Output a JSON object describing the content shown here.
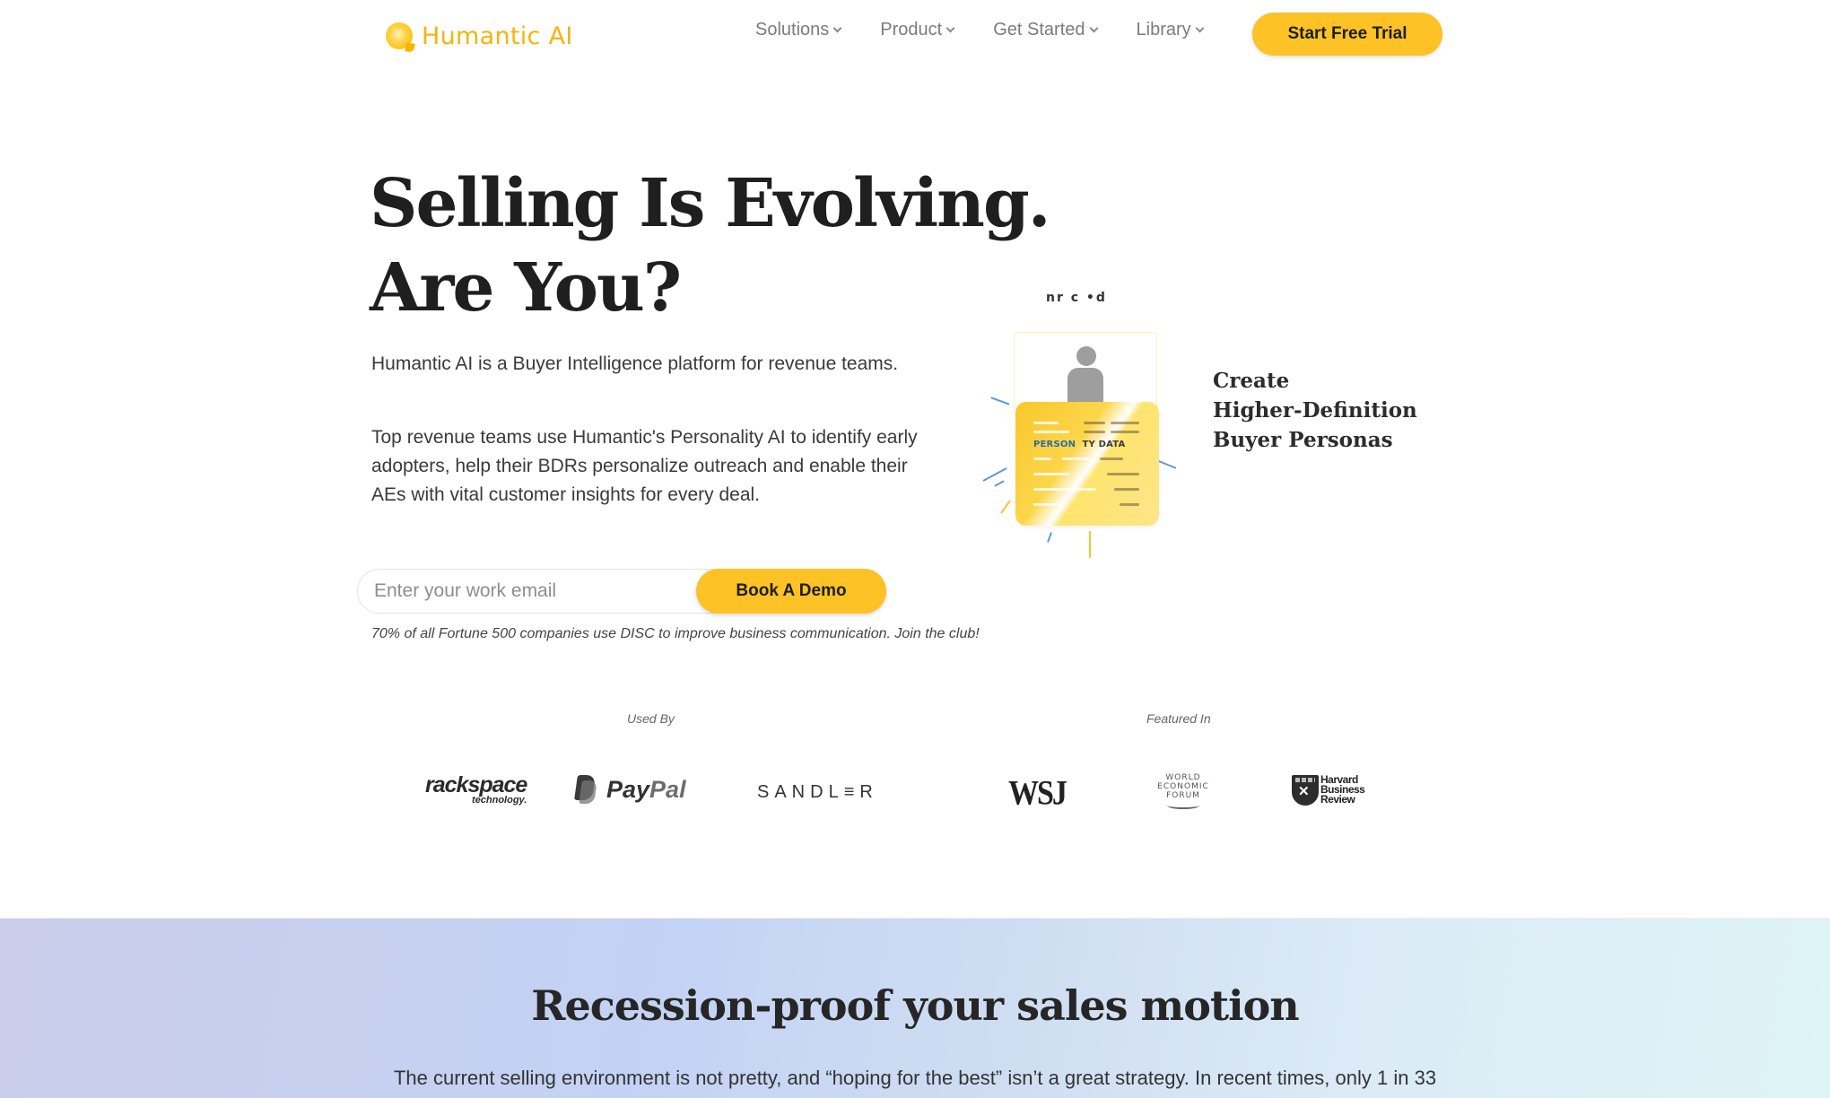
{
  "nav": {
    "logo_text": "Humantic AI",
    "menu": [
      {
        "label": "Solutions"
      },
      {
        "label": "Product"
      },
      {
        "label": "Get Started"
      },
      {
        "label": "Library"
      }
    ],
    "cta_label": "Start Free Trial"
  },
  "hero": {
    "title_line1": "Selling Is Evolving.",
    "title_line2": "Are You?",
    "paragraph1": "Humantic AI is a Buyer Intelligence platform for revenue teams.",
    "paragraph2": "Top revenue teams use Humantic's Personality AI to identify early adopters, help their BDRs personalize outreach and enable their AEs with vital customer insights for every deal.",
    "email_placeholder": "Enter your work email",
    "email_value": "",
    "demo_button_label": "Book A Demo",
    "fortune_note": "70% of all Fortune 500 companies use DISC to improve business communication. Join the club!"
  },
  "illustration": {
    "garbled_text": "nr c  •d",
    "card_label_part1": "PERSON",
    "card_label_part2": "  TY DATA",
    "feature_line1": "Create",
    "feature_line2": "Higher-Definition",
    "feature_line3": "Buyer Personas"
  },
  "logos": {
    "used_by_label": "Used By",
    "featured_in_label": "Featured In",
    "used_by": {
      "rackspace": "rackspace",
      "rackspace_sub": "technology.",
      "paypal_pay": "Pay",
      "paypal_pal": "Pal",
      "sandler": "SANDL≡R"
    },
    "featured_in": {
      "wsj": "WSJ",
      "wef_line1": "WORLD",
      "wef_line2": "ECONOMIC",
      "wef_line3": "FORUM",
      "hbr_line1": "Harvard",
      "hbr_line2": "Business",
      "hbr_line3": "Review"
    }
  },
  "section2": {
    "title": "Recession-proof your sales motion",
    "text": "The current selling environment is not pretty, and “hoping for the best” isn’t a great strategy. In recent times, only 1 in 33"
  },
  "colors": {
    "brand_yellow": "#fcc226",
    "logo_yellow": "#f5b40c",
    "heading_dark": "#1f1f1f"
  }
}
